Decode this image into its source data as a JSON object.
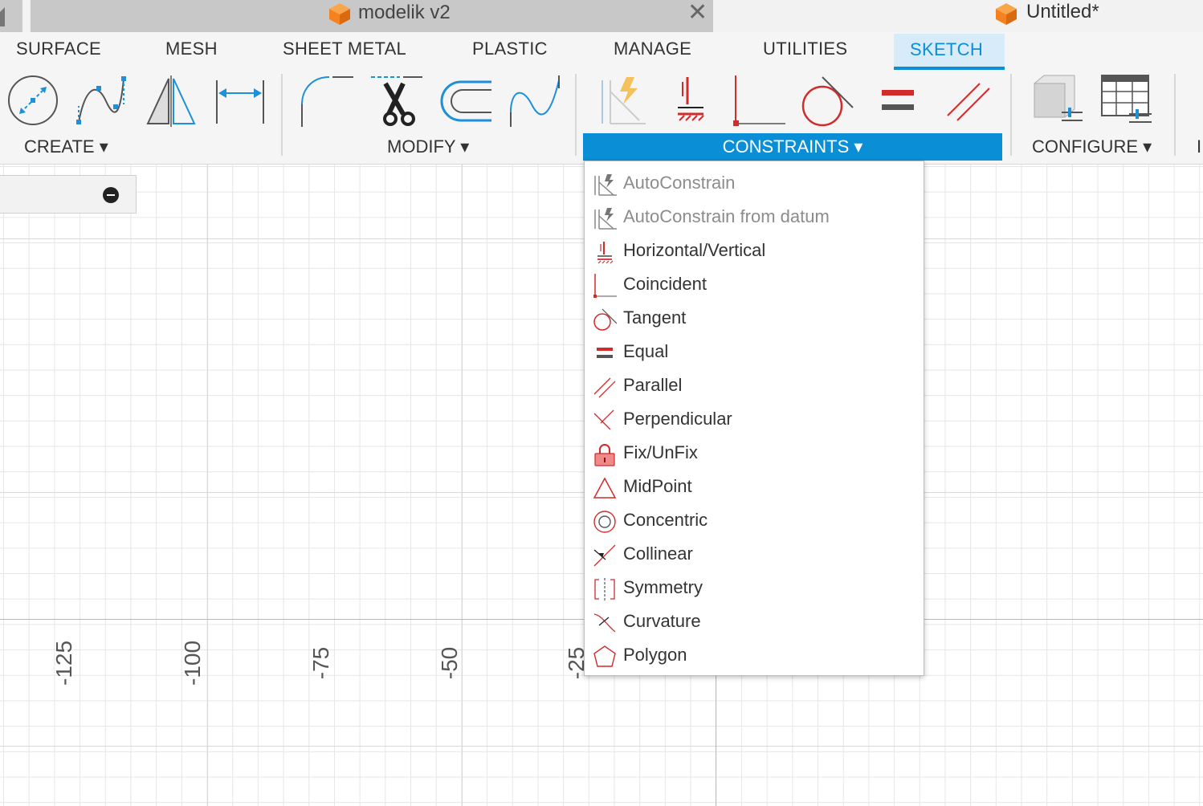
{
  "tabs": {
    "inactive_doc": "modelik v2",
    "close_glyph": "✕",
    "active_doc": "Untitled*"
  },
  "workspace_tabs": [
    "SURFACE",
    "MESH",
    "SHEET METAL",
    "PLASTIC",
    "MANAGE",
    "UTILITIES",
    "SKETCH"
  ],
  "active_workspace": "SKETCH",
  "groups": {
    "create": "CREATE ▾",
    "modify": "MODIFY ▾",
    "constraints": "CONSTRAINTS ▾",
    "configure": "CONFIGURE ▾",
    "inspect_stub": "I"
  },
  "axis_labels": [
    "-125",
    "-100",
    "-75",
    "-50",
    "-25"
  ],
  "constraints_menu": [
    {
      "label": "AutoConstrain",
      "icon": "autoconstrain-icon",
      "disabled": true
    },
    {
      "label": "AutoConstrain from datum",
      "icon": "autoconstrain-datum-icon",
      "disabled": true
    },
    {
      "label": "Horizontal/Vertical",
      "icon": "horizontal-vertical-icon",
      "disabled": false
    },
    {
      "label": "Coincident",
      "icon": "coincident-icon",
      "disabled": false
    },
    {
      "label": "Tangent",
      "icon": "tangent-icon",
      "disabled": false
    },
    {
      "label": "Equal",
      "icon": "equal-icon",
      "disabled": false
    },
    {
      "label": "Parallel",
      "icon": "parallel-icon",
      "disabled": false
    },
    {
      "label": "Perpendicular",
      "icon": "perpendicular-icon",
      "disabled": false
    },
    {
      "label": "Fix/UnFix",
      "icon": "lock-icon",
      "disabled": false
    },
    {
      "label": "MidPoint",
      "icon": "midpoint-icon",
      "disabled": false
    },
    {
      "label": "Concentric",
      "icon": "concentric-icon",
      "disabled": false
    },
    {
      "label": "Collinear",
      "icon": "collinear-icon",
      "disabled": false
    },
    {
      "label": "Symmetry",
      "icon": "symmetry-icon",
      "disabled": false
    },
    {
      "label": "Curvature",
      "icon": "curvature-icon",
      "disabled": false
    },
    {
      "label": "Polygon",
      "icon": "polygon-icon",
      "disabled": false
    }
  ],
  "colors": {
    "accent": "#0a8fd6",
    "constraint_red": "#d22b2b",
    "orange_cube": "#f5821f"
  }
}
